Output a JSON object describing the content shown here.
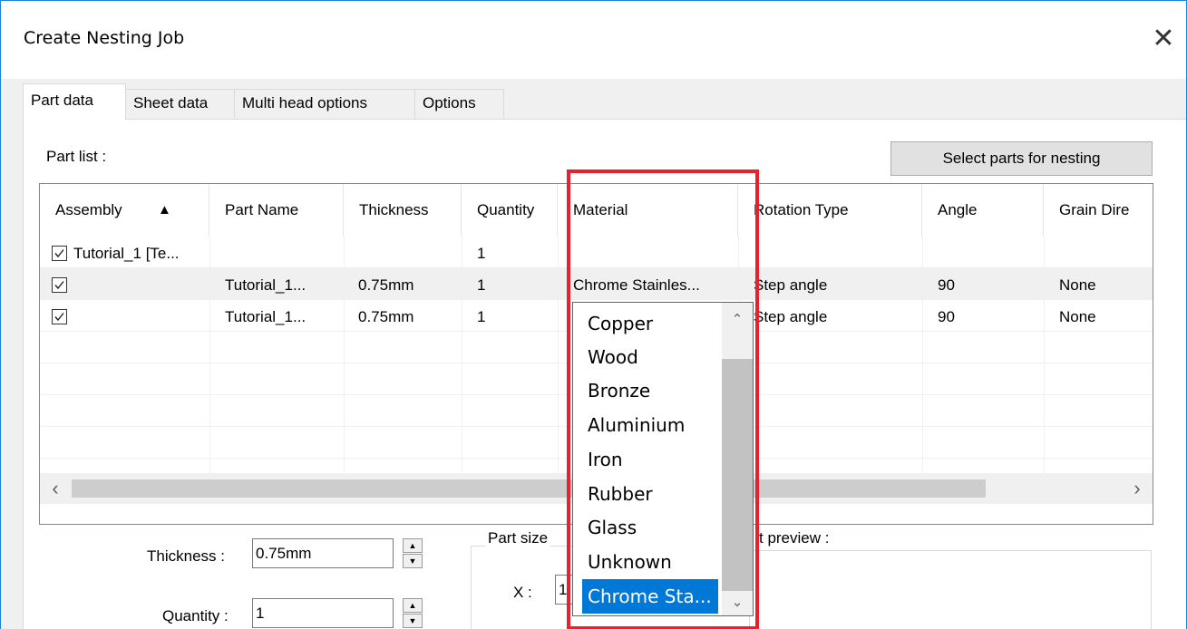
{
  "window": {
    "title": "Create Nesting Job",
    "close_glyph": "✕"
  },
  "tabs": [
    {
      "label": "Part data",
      "active": true
    },
    {
      "label": "Sheet data",
      "active": false
    },
    {
      "label": "Multi head options",
      "active": false
    },
    {
      "label": "Options",
      "active": false
    }
  ],
  "part_list": {
    "label": "Part list :",
    "select_button": "Select parts for nesting",
    "sort_indicator": "▲",
    "columns": [
      "Assembly",
      "Part Name",
      "Thickness",
      "Quantity",
      "Material",
      "Rotation Type",
      "Angle",
      "Grain Dire"
    ],
    "rows": [
      {
        "checked": true,
        "assembly": "Tutorial_1 [Te...",
        "part_name": "",
        "thickness": "",
        "quantity": "1",
        "material": "",
        "rotation_type": "",
        "angle": "",
        "grain": ""
      },
      {
        "checked": true,
        "assembly": "",
        "part_name": "Tutorial_1...",
        "thickness": "0.75mm",
        "quantity": "1",
        "material": "Chrome Stainles...",
        "rotation_type": "Step angle",
        "angle": "90",
        "grain": "None"
      },
      {
        "checked": true,
        "assembly": "",
        "part_name": "Tutorial_1...",
        "thickness": "0.75mm",
        "quantity": "1",
        "material": "",
        "rotation_type": "Step angle",
        "angle": "90",
        "grain": "None"
      }
    ],
    "scroll_left": "‹",
    "scroll_right": "›"
  },
  "material_dropdown": {
    "options": [
      "Copper",
      "Wood",
      "Bronze",
      "Aluminium",
      "Iron",
      "Rubber",
      "Glass",
      "Unknown",
      "Chrome Sta..."
    ],
    "selected_index": 8,
    "scroll_up": "⌃",
    "scroll_down": "⌄"
  },
  "fields": {
    "thickness_label": "Thickness :",
    "thickness_value": "0.75mm",
    "quantity_label": "Quantity :",
    "quantity_value": "1",
    "part_size_label": "Part size",
    "x_label": "X :",
    "x_value": "1",
    "preview_label": "t preview :"
  },
  "colors": {
    "accent": "#0078d7",
    "highlight_box": "#e8212c",
    "window_border": "#1883d7"
  }
}
